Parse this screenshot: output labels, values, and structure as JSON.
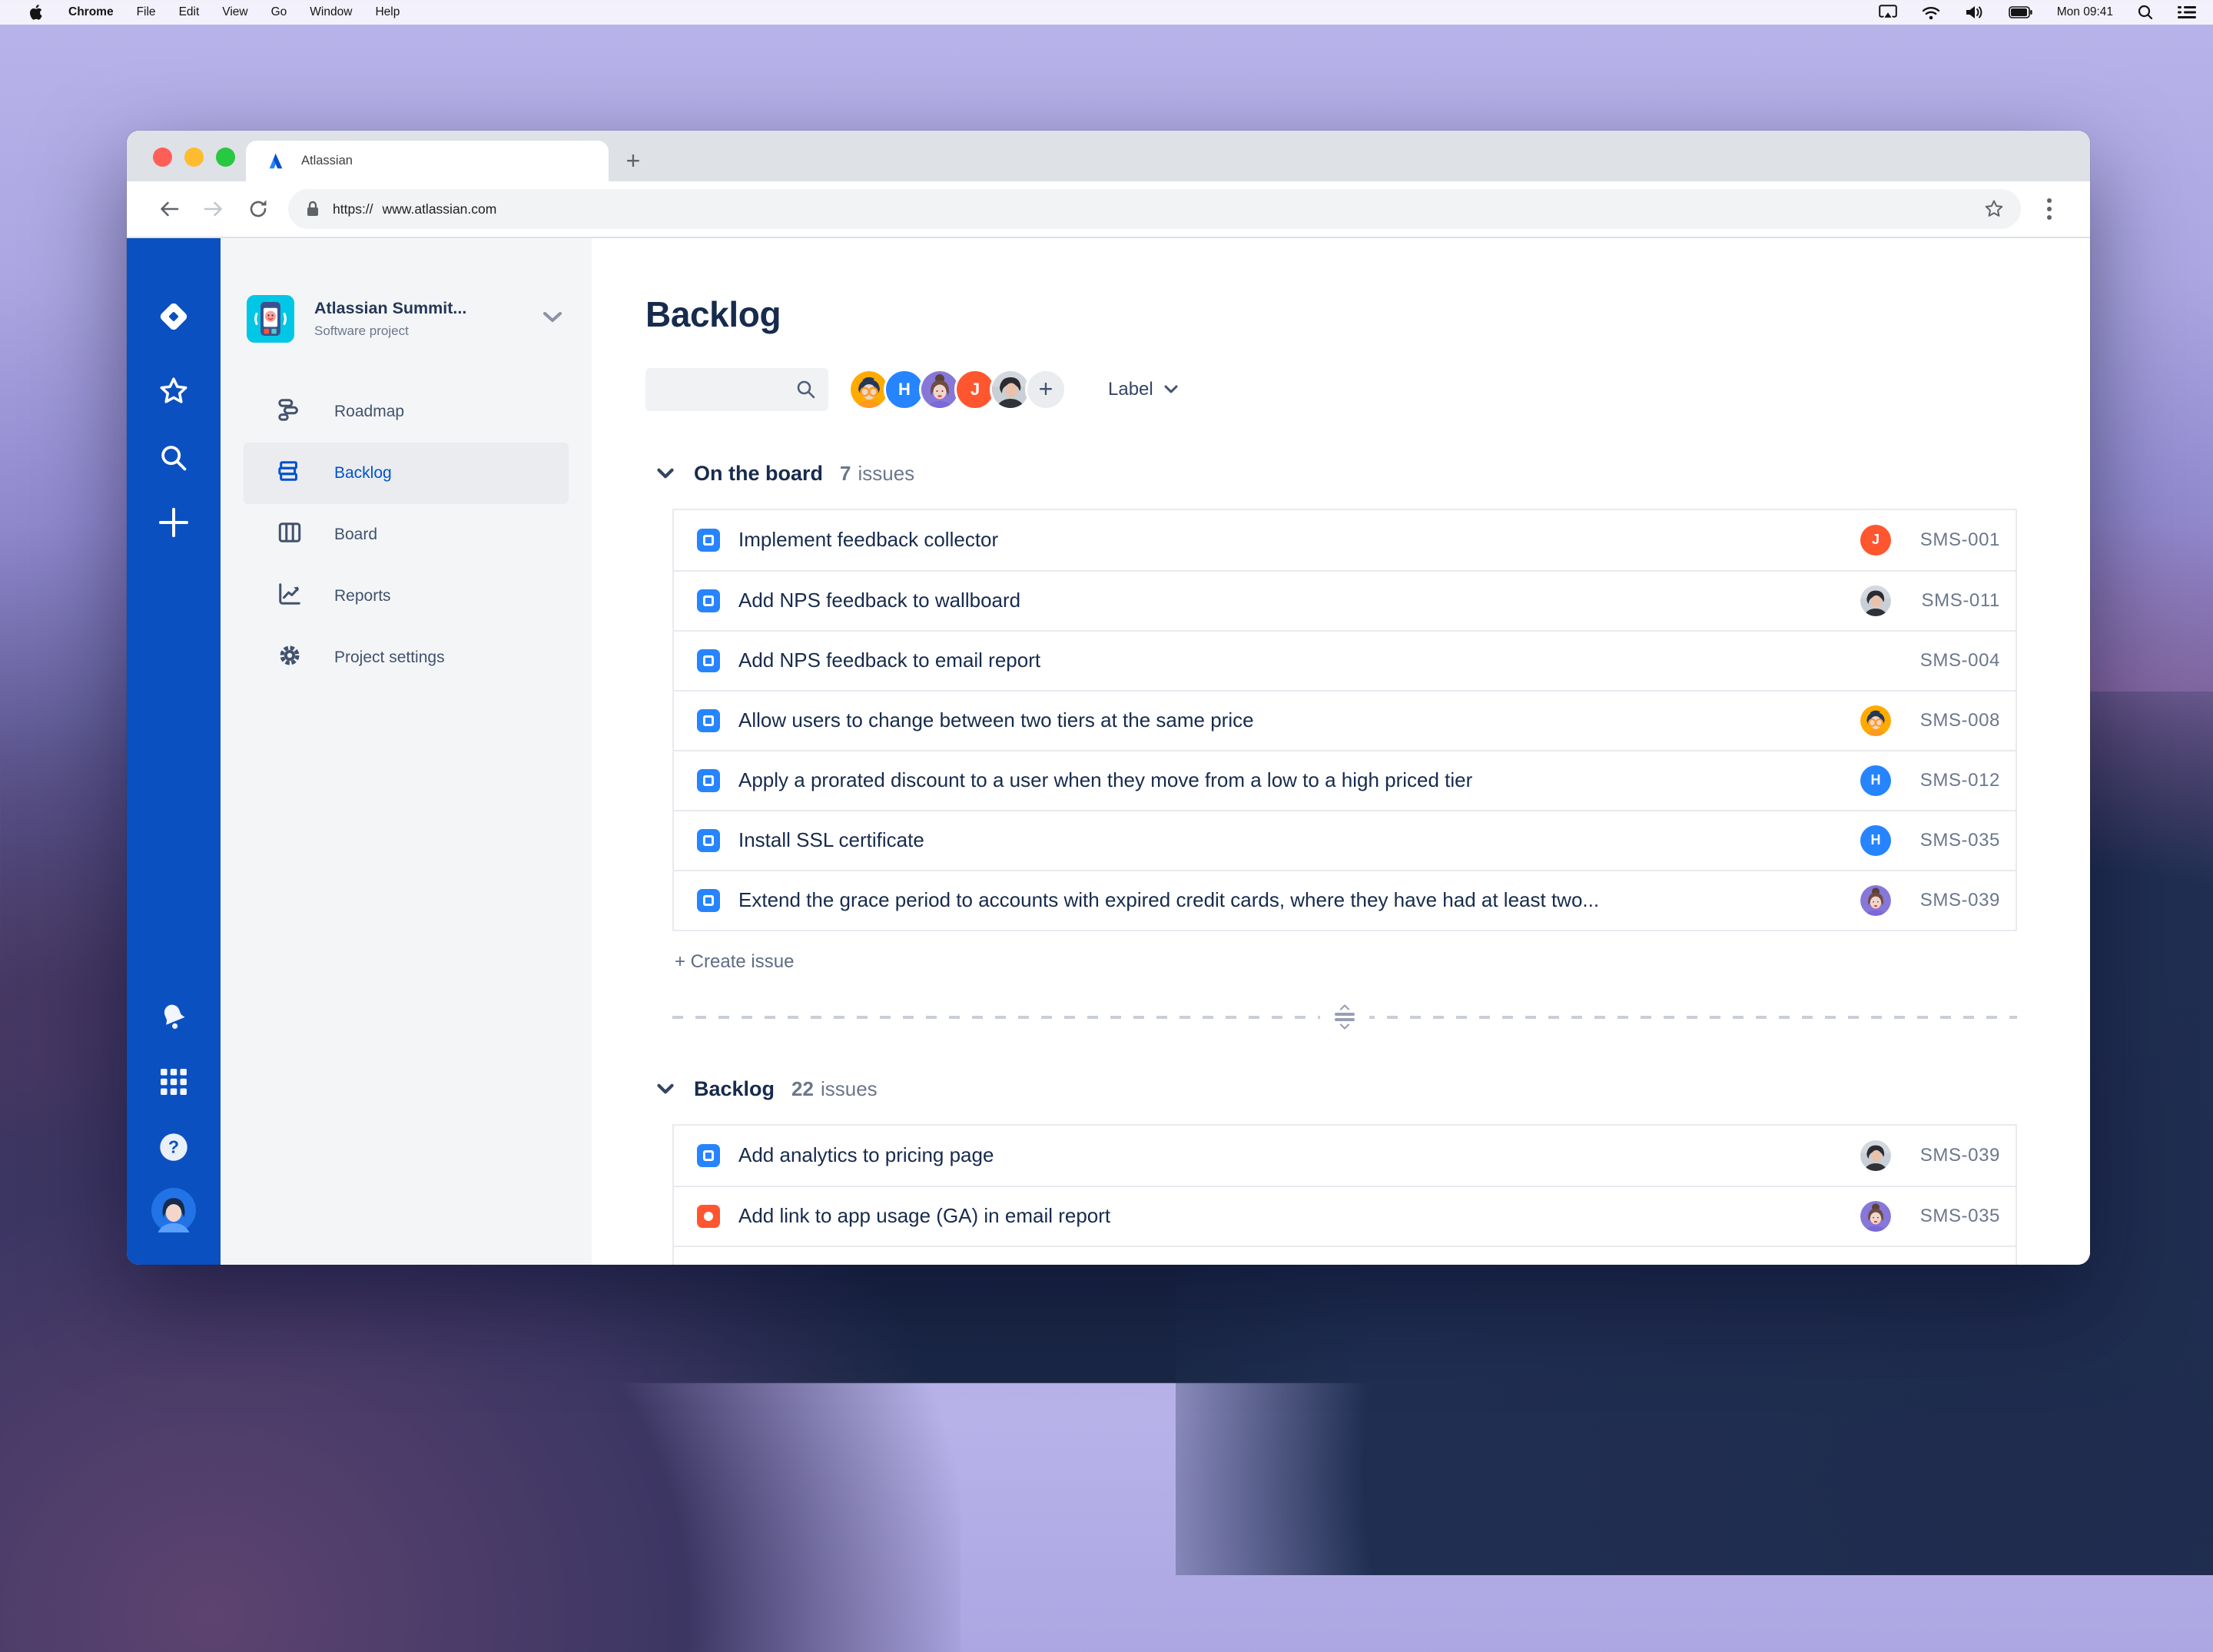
{
  "colors": {
    "rail_blue": "#0B50C0",
    "accent_blue": "#0052CC",
    "task_icon": "#2684FF",
    "bug_icon": "#FF5630",
    "selected_bg": "#EBECF0",
    "text_dark": "#172B4D",
    "text_muted": "#6B778C"
  },
  "menubar": {
    "items": [
      "Chrome",
      "File",
      "Edit",
      "View",
      "Go",
      "Window",
      "Help"
    ],
    "clock": "Mon 09:41"
  },
  "browser": {
    "tab_title": "Atlassian",
    "new_tab_label": "+",
    "url": {
      "scheme": "https://",
      "host": "www.atlassian.com"
    }
  },
  "project": {
    "name": "Atlassian Summit...",
    "type": "Software project"
  },
  "sidebar": {
    "items": [
      {
        "label": "Roadmap",
        "selected": false
      },
      {
        "label": "Backlog",
        "selected": true
      },
      {
        "label": "Board",
        "selected": false
      },
      {
        "label": "Reports",
        "selected": false
      },
      {
        "label": "Project settings",
        "selected": false
      }
    ]
  },
  "page": {
    "title": "Backlog"
  },
  "filters": {
    "label_dropdown": "Label",
    "avatars": [
      {
        "kind": "illustrated-orange"
      },
      {
        "kind": "initial",
        "letter": "H",
        "color": "#2684FF"
      },
      {
        "kind": "illustrated-purple"
      },
      {
        "kind": "initial",
        "letter": "J",
        "color": "#FF5630"
      },
      {
        "kind": "photo"
      },
      {
        "kind": "add-button",
        "label": "+"
      }
    ]
  },
  "board": {
    "title": "On the board",
    "count": "7",
    "suffix": "issues",
    "create_label": "+  Create issue",
    "issues": [
      {
        "type": "task",
        "title": "Implement feedback collector",
        "key": "SMS-001",
        "assignee": {
          "kind": "initial",
          "letter": "J",
          "color": "#FF5630"
        }
      },
      {
        "type": "task",
        "title": "Add NPS feedback to wallboard",
        "key": "SMS-011",
        "assignee": {
          "kind": "photo"
        }
      },
      {
        "type": "task",
        "title": "Add NPS feedback to email report",
        "key": "SMS-004",
        "assignee": {
          "kind": "none"
        }
      },
      {
        "type": "task",
        "title": "Allow users to change between two tiers at the same price",
        "key": "SMS-008",
        "assignee": {
          "kind": "illustrated-orange"
        }
      },
      {
        "type": "task",
        "title": "Apply a prorated discount to a user when they move from a low to a high priced tier",
        "key": "SMS-012",
        "assignee": {
          "kind": "initial",
          "letter": "H",
          "color": "#2684FF"
        }
      },
      {
        "type": "task",
        "title": "Install SSL certificate",
        "key": "SMS-035",
        "assignee": {
          "kind": "initial",
          "letter": "H",
          "color": "#2684FF"
        }
      },
      {
        "type": "task",
        "title": "Extend the grace period to accounts with expired credit cards, where they have had at least two...",
        "key": "SMS-039",
        "assignee": {
          "kind": "illustrated-purple"
        }
      }
    ]
  },
  "backlog": {
    "title": "Backlog",
    "count": "22",
    "suffix": "issues",
    "issues": [
      {
        "type": "task",
        "title": "Add analytics to pricing page",
        "key": "SMS-039",
        "assignee": {
          "kind": "photo"
        }
      },
      {
        "type": "bug",
        "title": "Add link to app usage (GA) in email report",
        "key": "SMS-035",
        "assignee": {
          "kind": "illustrated-purple"
        }
      }
    ]
  }
}
